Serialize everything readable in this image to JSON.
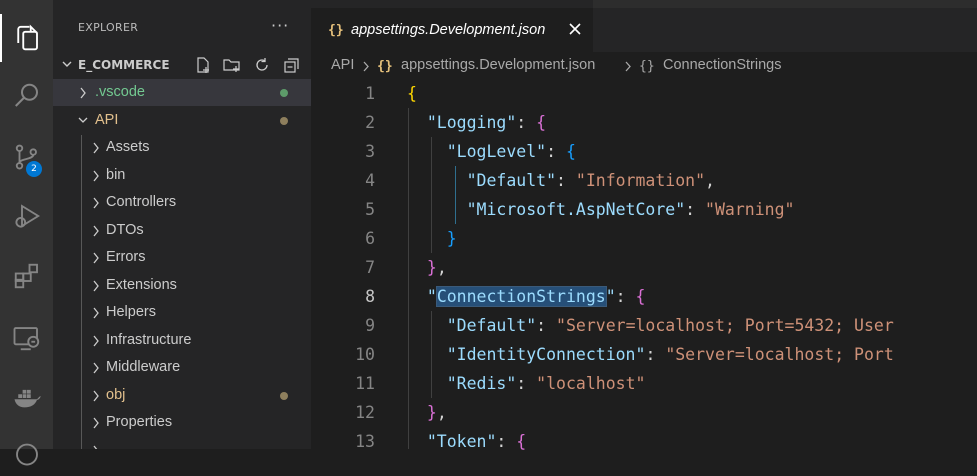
{
  "activity": {
    "badge_count": "2",
    "items": [
      "explorer-icon",
      "search-icon",
      "source-control-icon",
      "run-debug-icon",
      "extensions-icon",
      "remote-explorer-icon",
      "docker-icon"
    ]
  },
  "sidebar": {
    "title": "EXPLORER",
    "more": "···",
    "section_title": "E_COMMERCE",
    "items": [
      {
        "label": ".vscode",
        "color": "#73c991",
        "dot": "#5d9b6a",
        "level": 0,
        "expanded": false
      },
      {
        "label": "API",
        "color": "#e2c08d",
        "dot": "#8e7f5d",
        "level": 0,
        "expanded": true
      },
      {
        "label": "Assets",
        "color": "#cccccc",
        "level": 1,
        "expanded": false
      },
      {
        "label": "bin",
        "color": "#cccccc",
        "level": 1,
        "expanded": false
      },
      {
        "label": "Controllers",
        "color": "#cccccc",
        "level": 1,
        "expanded": false
      },
      {
        "label": "DTOs",
        "color": "#cccccc",
        "level": 1,
        "expanded": false
      },
      {
        "label": "Errors",
        "color": "#cccccc",
        "level": 1,
        "expanded": false
      },
      {
        "label": "Extensions",
        "color": "#cccccc",
        "level": 1,
        "expanded": false
      },
      {
        "label": "Helpers",
        "color": "#cccccc",
        "level": 1,
        "expanded": false
      },
      {
        "label": "Infrastructure",
        "color": "#cccccc",
        "level": 1,
        "expanded": false
      },
      {
        "label": "Middleware",
        "color": "#cccccc",
        "level": 1,
        "expanded": false
      },
      {
        "label": "obj",
        "color": "#e2c08d",
        "dot": "#8e7f5d",
        "level": 1,
        "expanded": false
      },
      {
        "label": "Properties",
        "color": "#cccccc",
        "level": 1,
        "expanded": false
      },
      {
        "label": "",
        "color": "#cccccc",
        "level": 1,
        "expanded": false
      }
    ]
  },
  "editor": {
    "tab": {
      "icon": "{}",
      "label": "appsettings.Development.json"
    },
    "breadcrumb": [
      "API",
      "appsettings.Development.json",
      "ConnectionStrings"
    ],
    "breadcrumb_icon": "{}",
    "active_line": 8,
    "lines": [
      {
        "n": "1",
        "tokens": [
          [
            "b1",
            "{"
          ]
        ]
      },
      {
        "n": "2",
        "tokens": [
          [
            "p",
            "  "
          ],
          [
            "k",
            "\"Logging\""
          ],
          [
            "p",
            ": "
          ],
          [
            "b2",
            "{"
          ]
        ]
      },
      {
        "n": "3",
        "tokens": [
          [
            "p",
            "    "
          ],
          [
            "k",
            "\"LogLevel\""
          ],
          [
            "p",
            ": "
          ],
          [
            "b3",
            "{"
          ]
        ]
      },
      {
        "n": "4",
        "tokens": [
          [
            "p",
            "      "
          ],
          [
            "k",
            "\"Default\""
          ],
          [
            "p",
            ": "
          ],
          [
            "s",
            "\"Information\""
          ],
          [
            "p",
            ","
          ]
        ]
      },
      {
        "n": "5",
        "tokens": [
          [
            "p",
            "      "
          ],
          [
            "k",
            "\"Microsoft.AspNetCore\""
          ],
          [
            "p",
            ": "
          ],
          [
            "s",
            "\"Warning\""
          ]
        ]
      },
      {
        "n": "6",
        "tokens": [
          [
            "p",
            "    "
          ],
          [
            "b3",
            "}"
          ]
        ]
      },
      {
        "n": "7",
        "tokens": [
          [
            "p",
            "  "
          ],
          [
            "b2",
            "}"
          ],
          [
            "p",
            ","
          ]
        ]
      },
      {
        "n": "8",
        "tokens": [
          [
            "p",
            "  "
          ],
          [
            "k",
            "\""
          ],
          [
            "hl",
            "ConnectionStrings"
          ],
          [
            "k",
            "\""
          ],
          [
            "p",
            ": "
          ],
          [
            "b2",
            "{"
          ]
        ]
      },
      {
        "n": "9",
        "tokens": [
          [
            "p",
            "    "
          ],
          [
            "k",
            "\"Default\""
          ],
          [
            "p",
            ": "
          ],
          [
            "s",
            "\"Server=localhost; Port=5432; User"
          ]
        ]
      },
      {
        "n": "10",
        "tokens": [
          [
            "p",
            "    "
          ],
          [
            "k",
            "\"IdentityConnection\""
          ],
          [
            "p",
            ": "
          ],
          [
            "s",
            "\"Server=localhost; Port"
          ]
        ]
      },
      {
        "n": "11",
        "tokens": [
          [
            "p",
            "    "
          ],
          [
            "k",
            "\"Redis\""
          ],
          [
            "p",
            ": "
          ],
          [
            "s",
            "\"localhost\""
          ]
        ]
      },
      {
        "n": "12",
        "tokens": [
          [
            "p",
            "  "
          ],
          [
            "b2",
            "}"
          ],
          [
            "p",
            ","
          ]
        ]
      },
      {
        "n": "13",
        "tokens": [
          [
            "p",
            "  "
          ],
          [
            "k",
            "\"Token\""
          ],
          [
            "p",
            ": "
          ],
          [
            "b2",
            "{"
          ]
        ]
      }
    ]
  }
}
